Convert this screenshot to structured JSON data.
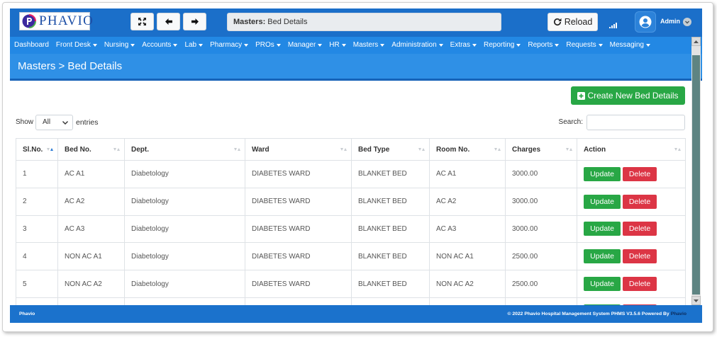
{
  "colors": {
    "topbar": "#1b6fc9",
    "nav": "#2388e4",
    "title_band": "#2f90e6",
    "title_border": "#1763b8",
    "footer": "#1b72cc",
    "success": "#28a745",
    "danger": "#dc3545",
    "sort_active": "#2a7ad5",
    "scroll_thumb": "#5e8482"
  },
  "app": {
    "logo_text": "PHAVIO",
    "logo_icon": "phavio-emblem-icon"
  },
  "header": {
    "fullscreen_icon": "expand-icon",
    "back_icon": "arrow-left-icon",
    "forward_icon": "arrow-right-icon",
    "breadcrumb": {
      "label": "Masters:",
      "value": "Bed Details"
    },
    "reload": {
      "label": "Reload",
      "icon": "refresh-icon"
    },
    "signal_icon": "signal-icon",
    "user": {
      "name": "Admin",
      "avatar_icon": "user-circle-icon",
      "menu_icon": "chevron-down-circle-icon"
    }
  },
  "nav": {
    "items": [
      {
        "label": "Dashboard",
        "dropdown": false
      },
      {
        "label": "Front Desk",
        "dropdown": true
      },
      {
        "label": "Nursing",
        "dropdown": true
      },
      {
        "label": "Accounts",
        "dropdown": true
      },
      {
        "label": "Lab",
        "dropdown": true
      },
      {
        "label": "Pharmacy",
        "dropdown": true
      },
      {
        "label": "PROs",
        "dropdown": true
      },
      {
        "label": "Manager",
        "dropdown": true
      },
      {
        "label": "HR",
        "dropdown": true
      },
      {
        "label": "Masters",
        "dropdown": true
      },
      {
        "label": "Administration",
        "dropdown": true
      },
      {
        "label": "Extras",
        "dropdown": true
      },
      {
        "label": "Reporting",
        "dropdown": true
      },
      {
        "label": "Reports",
        "dropdown": true
      },
      {
        "label": "Requests",
        "dropdown": true
      },
      {
        "label": "Messaging",
        "dropdown": true
      }
    ]
  },
  "page": {
    "title": "Masters > Bed Details",
    "create_button": {
      "label": "Create New Bed Details",
      "icon": "plus-square-icon"
    }
  },
  "table_controls": {
    "show_label": "Show",
    "page_length": "All",
    "entries_label": "entries",
    "search_label": "Search:",
    "search_value": ""
  },
  "table": {
    "columns": [
      {
        "label": "Sl.No.",
        "sort": "asc"
      },
      {
        "label": "Bed No."
      },
      {
        "label": "Dept."
      },
      {
        "label": "Ward"
      },
      {
        "label": "Bed Type"
      },
      {
        "label": "Room No."
      },
      {
        "label": "Charges"
      },
      {
        "label": "Action"
      }
    ],
    "actions": {
      "update": "Update",
      "delete": "Delete"
    },
    "rows": [
      {
        "sl_no": "1",
        "bed_no": "AC A1",
        "dept": "Diabetology",
        "ward": "DIABETES WARD",
        "bed_type": "BLANKET BED",
        "room_no": "AC A1",
        "charges": "3000.00"
      },
      {
        "sl_no": "2",
        "bed_no": "AC A2",
        "dept": "Diabetology",
        "ward": "DIABETES WARD",
        "bed_type": "BLANKET BED",
        "room_no": "AC A2",
        "charges": "3000.00"
      },
      {
        "sl_no": "3",
        "bed_no": "AC A3",
        "dept": "Diabetology",
        "ward": "DIABETES WARD",
        "bed_type": "BLANKET BED",
        "room_no": "AC A3",
        "charges": "3000.00"
      },
      {
        "sl_no": "4",
        "bed_no": "NON AC A1",
        "dept": "Diabetology",
        "ward": "DIABETES WARD",
        "bed_type": "BLANKET BED",
        "room_no": "NON AC A1",
        "charges": "2500.00"
      },
      {
        "sl_no": "5",
        "bed_no": "NON AC A2",
        "dept": "Diabetology",
        "ward": "DIABETES WARD",
        "bed_type": "BLANKET BED",
        "room_no": "NON AC A2",
        "charges": "2500.00"
      },
      {
        "sl_no": "",
        "bed_no": "",
        "dept": "",
        "ward": "",
        "bed_type": "",
        "room_no": "",
        "charges": ""
      }
    ]
  },
  "footer": {
    "left": "Phavio",
    "copyright": "© 2022 Phavio Hospital Management System PHMS V3.5.6 Powered By",
    "powered_by": "Phavio"
  }
}
